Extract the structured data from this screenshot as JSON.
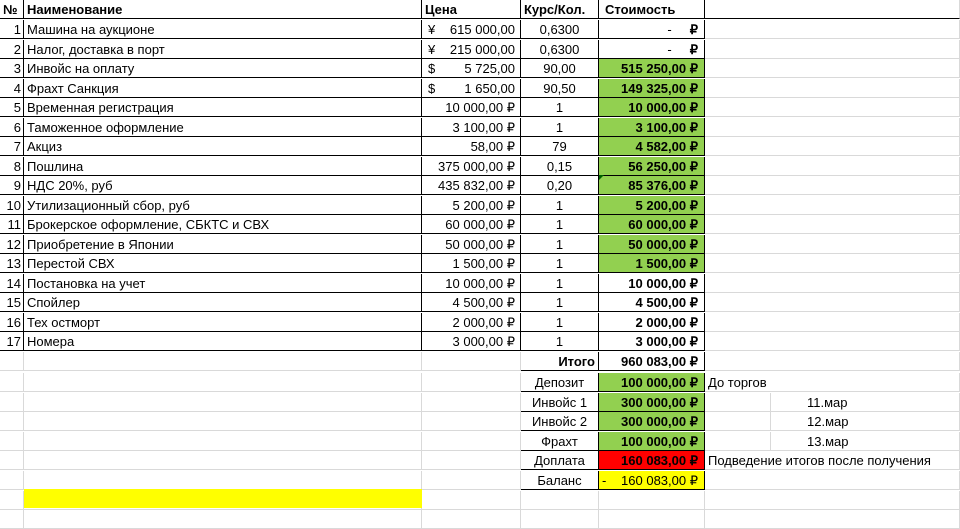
{
  "header": {
    "no": "№",
    "name": "Наименование",
    "price": "Цена",
    "rate": "Курс/Кол.",
    "cost": "Стоимость"
  },
  "rows": [
    {
      "no": "1",
      "name": "Машина на аукционе",
      "price_sym": "¥",
      "price": "615 000,00",
      "rate": "0,6300",
      "cost": "-",
      "cost_sym": "₽",
      "green": false,
      "bold": false
    },
    {
      "no": "2",
      "name": "Налог, доставка в порт",
      "price_sym": "¥",
      "price": "215 000,00",
      "rate": "0,6300",
      "cost": "-",
      "cost_sym": "₽",
      "green": false,
      "bold": false
    },
    {
      "no": "3",
      "name": "Инвойс на оплату",
      "price_sym": "$",
      "price": "5 725,00",
      "rate": "90,00",
      "cost": "515 250,00 ₽",
      "green": true,
      "bold": true
    },
    {
      "no": "4",
      "name": "Фрахт Санкция",
      "price_sym": "$",
      "price": "1 650,00",
      "rate": "90,50",
      "cost": "149 325,00 ₽",
      "green": true,
      "bold": true
    },
    {
      "no": "5",
      "name": "Временная регистрация",
      "price_sym": "",
      "price": "10 000,00 ₽",
      "rate": "1",
      "cost": "10 000,00 ₽",
      "green": true,
      "bold": true
    },
    {
      "no": "6",
      "name": "Таможенное оформление",
      "price_sym": "",
      "price": "3 100,00 ₽",
      "rate": "1",
      "cost": "3 100,00 ₽",
      "green": true,
      "bold": true
    },
    {
      "no": "7",
      "name": "Акциз",
      "price_sym": "",
      "price": "58,00 ₽",
      "rate": "79",
      "cost": "4 582,00 ₽",
      "green": true,
      "bold": true
    },
    {
      "no": "8",
      "name": "Пошлина",
      "price_sym": "",
      "price": "375 000,00 ₽",
      "rate": "0,15",
      "cost": "56 250,00 ₽",
      "green": true,
      "bold": true
    },
    {
      "no": "9",
      "name": "НДС 20%, руб",
      "price_sym": "",
      "price": "435 832,00 ₽",
      "rate": "0,20",
      "cost": "85 376,00 ₽",
      "green": true,
      "bold": true
    },
    {
      "no": "10",
      "name": "Утилизационный сбор, руб",
      "price_sym": "",
      "price": "5 200,00 ₽",
      "rate": "1",
      "cost": "5 200,00 ₽",
      "green": true,
      "bold": true
    },
    {
      "no": "11",
      "name": "Брокерское оформление, СБКТС и СВХ",
      "price_sym": "",
      "price": "60 000,00 ₽",
      "rate": "1",
      "cost": "60 000,00 ₽",
      "green": true,
      "bold": true
    },
    {
      "no": "12",
      "name": "Приобретение в Японии",
      "price_sym": "",
      "price": "50 000,00 ₽",
      "rate": "1",
      "cost": "50 000,00 ₽",
      "green": true,
      "bold": true
    },
    {
      "no": "13",
      "name": "Перестой СВХ",
      "price_sym": "",
      "price": "1 500,00 ₽",
      "rate": "1",
      "cost": "1 500,00 ₽",
      "green": true,
      "bold": true
    },
    {
      "no": "14",
      "name": "Постановка на учет",
      "price_sym": "",
      "price": "10 000,00 ₽",
      "rate": "1",
      "cost": "10 000,00 ₽",
      "green": false,
      "bold": true
    },
    {
      "no": "15",
      "name": "Спойлер",
      "price_sym": "",
      "price": "4 500,00 ₽",
      "rate": "1",
      "cost": "4 500,00 ₽",
      "green": false,
      "bold": true
    },
    {
      "no": "16",
      "name": "Тех остморт",
      "price_sym": "",
      "price": "2 000,00 ₽",
      "rate": "1",
      "cost": "2 000,00 ₽",
      "green": false,
      "bold": true
    },
    {
      "no": "17",
      "name": "Номера",
      "price_sym": "",
      "price": "3 000,00 ₽",
      "rate": "1",
      "cost": "3 000,00 ₽",
      "green": false,
      "bold": true
    }
  ],
  "total": {
    "label": "Итого",
    "value": "960 083,00 ₽"
  },
  "summary": [
    {
      "label": "Депозит",
      "value": "100 000,00 ₽",
      "fill": "green",
      "note": "До торгов",
      "date": ""
    },
    {
      "label": "Инвойс 1",
      "value": "300 000,00 ₽",
      "fill": "green",
      "note": "",
      "date": "11.мар"
    },
    {
      "label": "Инвойс 2",
      "value": "300 000,00 ₽",
      "fill": "green",
      "note": "",
      "date": "12.мар"
    },
    {
      "label": "Фрахт",
      "value": "100 000,00 ₽",
      "fill": "green",
      "note": "",
      "date": "13.мар"
    },
    {
      "label": "Доплата",
      "value": "160 083,00 ₽",
      "fill": "red",
      "note": "Подведение итогов после получения",
      "date": ""
    },
    {
      "label": "Баланс",
      "value": "160 083,00 ₽",
      "value_prefix": "-",
      "fill": "yellow",
      "note": "",
      "date": ""
    }
  ],
  "colors": {
    "green": "#92d050",
    "red": "#ff0000",
    "yellow": "#ffff00"
  }
}
